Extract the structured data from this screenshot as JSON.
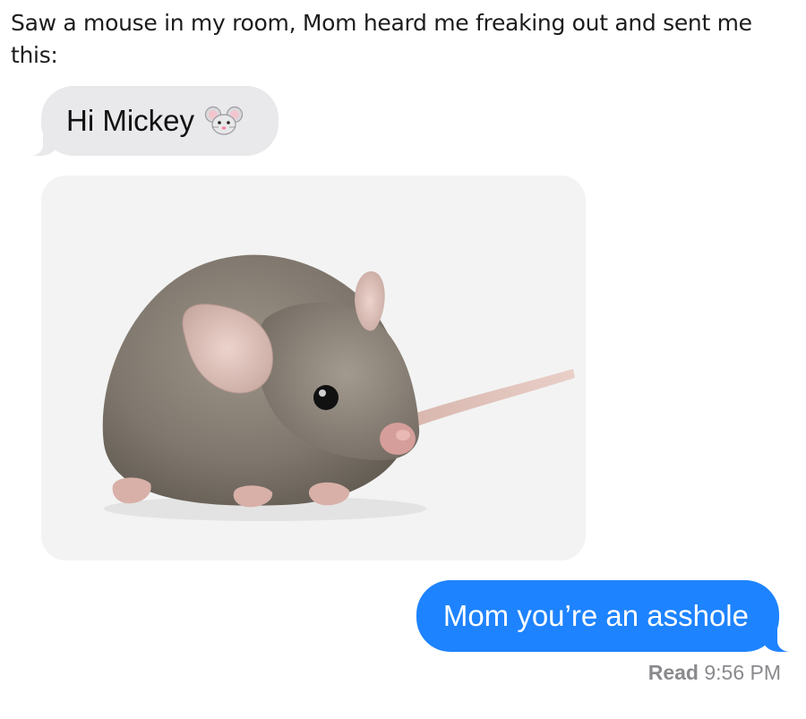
{
  "post": {
    "caption": "Saw a mouse in my room, Mom heard me freaking out and sent me this:"
  },
  "thread": {
    "messages": [
      {
        "direction": "incoming",
        "text": "Hi Mickey",
        "emoji": "mouse-face-icon"
      },
      {
        "direction": "incoming",
        "attachment": "mouse-photo"
      },
      {
        "direction": "outgoing",
        "text": "Mom you’re an asshole"
      }
    ],
    "receipt": {
      "status": "Read",
      "time": "9:56 PM"
    }
  },
  "colors": {
    "incoming_bubble": "#e9e9eb",
    "outgoing_bubble": "#1e83ff",
    "receipt_text": "#8a8a8e"
  }
}
